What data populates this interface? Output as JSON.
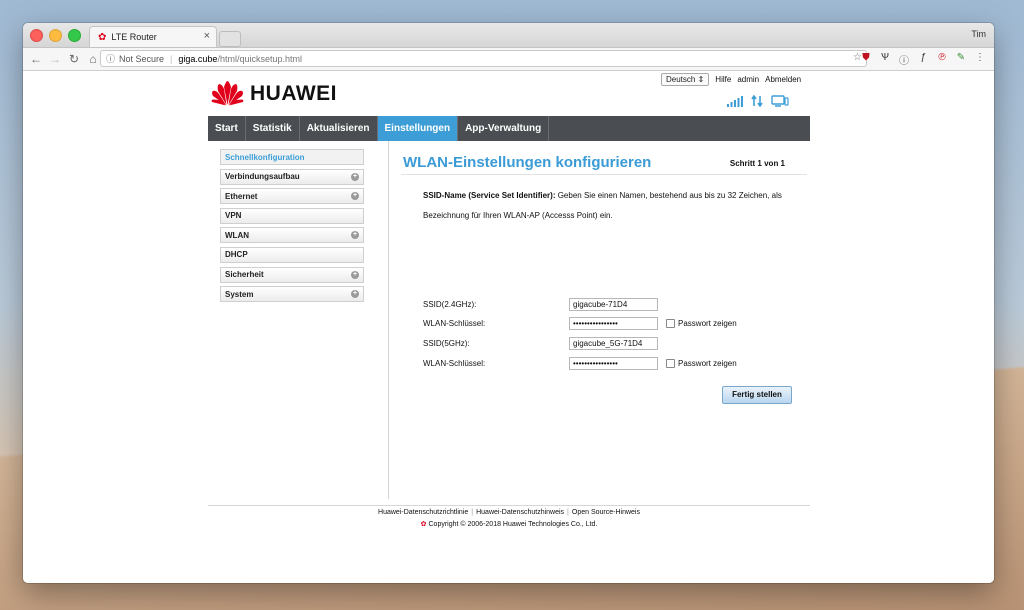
{
  "browser": {
    "tab_title": "LTE Router",
    "tab_close": "×",
    "user": "Tim",
    "not_secure": "Not Secure",
    "host": "giga.cube",
    "path": "/html/quicksetup.html"
  },
  "header": {
    "brand": "HUAWEI",
    "language": "Deutsch",
    "links": {
      "help": "Hilfe",
      "admin": "admin",
      "logout": "Abmelden"
    }
  },
  "nav": {
    "items": [
      {
        "label": "Start"
      },
      {
        "label": "Statistik"
      },
      {
        "label": "Aktualisieren"
      },
      {
        "label": "Einstellungen"
      },
      {
        "label": "App-Verwaltung"
      }
    ]
  },
  "sidebar": {
    "items": [
      {
        "label": "Schnellkonfiguration"
      },
      {
        "label": "Verbindungsaufbau"
      },
      {
        "label": "Ethernet"
      },
      {
        "label": "VPN"
      },
      {
        "label": "WLAN"
      },
      {
        "label": "DHCP"
      },
      {
        "label": "Sicherheit"
      },
      {
        "label": "System"
      }
    ]
  },
  "content": {
    "title": "WLAN-Einstellungen konfigurieren",
    "step": "Schritt 1 von 1",
    "desc_bold": "SSID-Name (Service Set Identifier):",
    "desc_text": " Geben Sie einen Namen, bestehend aus bis zu 32 Zeichen, als Bezeichnung für Ihren WLAN-AP (Accesss Point) ein.",
    "fields": [
      {
        "label": "SSID(2.4GHz):",
        "value": "gigacube-71D4"
      },
      {
        "label": "WLAN-Schlüssel:",
        "value": "••••••••••••••••",
        "checkbox": "Passwort zeigen"
      },
      {
        "label": "SSID(5GHz):",
        "value": "gigacube_5G-71D4"
      },
      {
        "label": "WLAN-Schlüssel:",
        "value": "••••••••••••••••",
        "checkbox": "Passwort zeigen"
      }
    ],
    "finish_label": "Fertig stellen"
  },
  "footer": {
    "links": [
      "Huawei-Datenschutzrichtlinie",
      "Huawei-Datenschutzhinweis",
      "Open Source-Hinweis"
    ],
    "copyright": "Copyright © 2006-2018 Huawei Technologies Co., Ltd."
  }
}
